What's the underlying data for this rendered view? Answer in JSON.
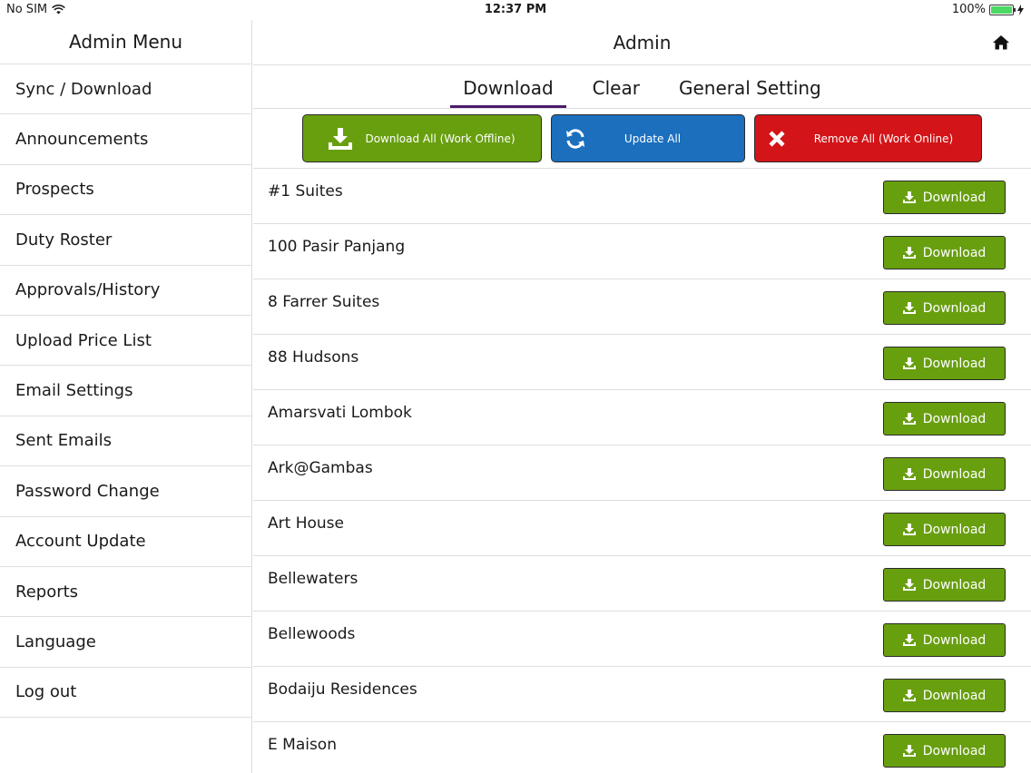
{
  "status": {
    "carrier": "No SIM",
    "time": "12:37 PM",
    "battery": "100%"
  },
  "sidebar": {
    "title": "Admin Menu",
    "items": [
      {
        "label": "Sync / Download"
      },
      {
        "label": "Announcements"
      },
      {
        "label": "Prospects"
      },
      {
        "label": "Duty Roster"
      },
      {
        "label": "Approvals/History"
      },
      {
        "label": "Upload Price List"
      },
      {
        "label": "Email Settings"
      },
      {
        "label": "Sent Emails"
      },
      {
        "label": "Password Change"
      },
      {
        "label": "Account Update"
      },
      {
        "label": "Reports"
      },
      {
        "label": "Language"
      },
      {
        "label": "Log out"
      }
    ]
  },
  "header": {
    "title": "Admin"
  },
  "tabs": [
    {
      "label": "Download",
      "active": true
    },
    {
      "label": "Clear"
    },
    {
      "label": "General Setting"
    }
  ],
  "actions": {
    "download_all": "Download All (Work Offline)",
    "update_all": "Update All",
    "remove_all": "Remove All (Work Online)"
  },
  "colors": {
    "green": "#689f0f",
    "blue": "#1b6fbd",
    "red": "#d31418",
    "tab_underline": "#4b1b6b"
  },
  "download_label": "Download",
  "projects": [
    {
      "name": "#1 Suites"
    },
    {
      "name": "100 Pasir Panjang"
    },
    {
      "name": "8 Farrer Suites"
    },
    {
      "name": "88 Hudsons"
    },
    {
      "name": "Amarsvati Lombok"
    },
    {
      "name": "Ark@Gambas"
    },
    {
      "name": "Art House"
    },
    {
      "name": "Bellewaters"
    },
    {
      "name": "Bellewoods"
    },
    {
      "name": "Bodaiju Residences"
    },
    {
      "name": "E Maison"
    }
  ]
}
